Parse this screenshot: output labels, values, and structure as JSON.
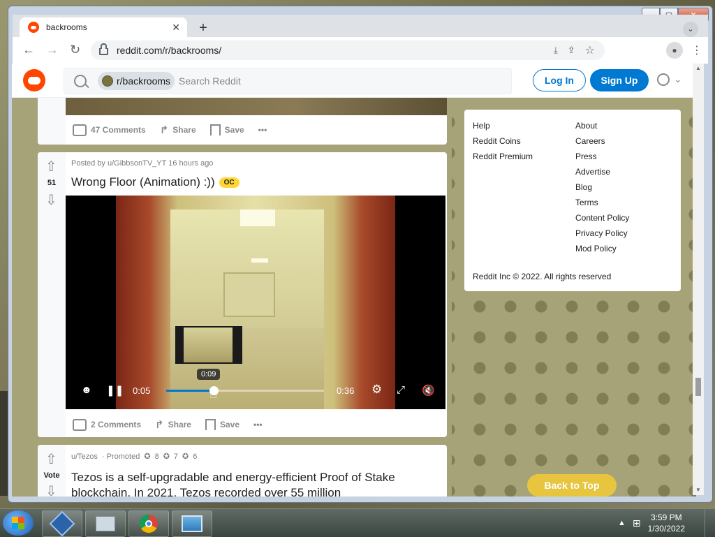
{
  "browser": {
    "tab_title": "backrooms",
    "tab_close": "✕",
    "new_tab": "+",
    "tab_search": "⌄",
    "url": "reddit.com/r/backrooms/",
    "back": "←",
    "forward": "→",
    "reload": "↻",
    "install_icon": "⤓",
    "share_icon": "⇪",
    "star_icon": "☆",
    "menu_icon": "⋮",
    "win_min": "▁",
    "win_max": "▢",
    "win_close": "✕"
  },
  "reddit_header": {
    "community_chip": "r/backrooms",
    "search_placeholder": "Search Reddit",
    "login": "Log In",
    "signup": "Sign Up",
    "user_menu_chevron": "⌄"
  },
  "feed": {
    "prev_post": {
      "comments": "47 Comments",
      "share": "Share",
      "save": "Save",
      "more": "•••"
    },
    "post": {
      "votes": "51",
      "meta": "Posted by u/GibbsonTV_YT 16 hours ago",
      "title": "Wrong Floor (Animation) :))",
      "flair": "OC",
      "comments": "2 Comments",
      "share": "Share",
      "save": "Save",
      "more": "•••",
      "video": {
        "current_time": "0:05",
        "hover_time": "0:09",
        "duration": "0:36",
        "progress": 0.3
      }
    },
    "promoted": {
      "vote_label": "Vote",
      "author": "u/Tezos",
      "promoted": "· Promoted",
      "award1": "8",
      "award2": "7",
      "award3": "6",
      "title": "Tezos is a self-upgradable and energy-efficient Proof of Stake blockchain. In 2021, Tezos recorded over 55 million"
    }
  },
  "sidebar": {
    "col1": [
      "Help",
      "Reddit Coins",
      "Reddit Premium"
    ],
    "col2": [
      "About",
      "Careers",
      "Press",
      "Advertise",
      "Blog",
      "Terms",
      "Content Policy",
      "Privacy Policy",
      "Mod Policy"
    ],
    "copyright": "Reddit Inc © 2022. All rights reserved",
    "back_to_top": "Back to Top"
  },
  "taskbar": {
    "time": "3:59 PM",
    "date": "1/30/2022",
    "tray_up": "▲"
  },
  "colors": {
    "reddit_orange": "#ff4500",
    "reddit_blue": "#0079d3",
    "flair_yellow": "#ffd635",
    "back_to_top": "#e8c53e"
  }
}
